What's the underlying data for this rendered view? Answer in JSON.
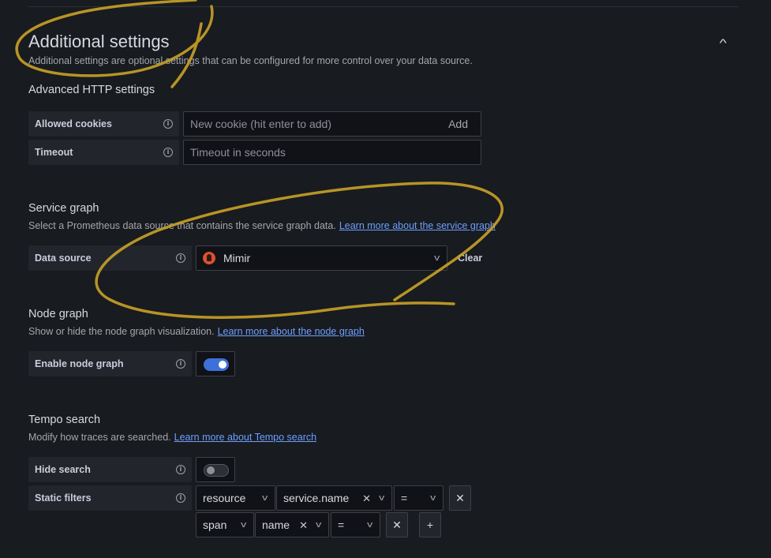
{
  "section": {
    "title": "Additional settings",
    "description": "Additional settings are optional settings that can be configured for more control over your data source."
  },
  "http": {
    "heading": "Advanced HTTP settings",
    "allowed_cookies_label": "Allowed cookies",
    "cookie_placeholder": "New cookie (hit enter to add)",
    "add_label": "Add",
    "timeout_label": "Timeout",
    "timeout_placeholder": "Timeout in seconds"
  },
  "service_graph": {
    "heading": "Service graph",
    "description": "Select a Prometheus data source that contains the service graph data.",
    "link": "Learn more about the service graph",
    "datasource_label": "Data source",
    "datasource_value": "Mimir",
    "clear_label": "Clear"
  },
  "node_graph": {
    "heading": "Node graph",
    "description": "Show or hide the node graph visualization.",
    "link": "Learn more about the node graph",
    "enable_label": "Enable node graph",
    "enabled": true
  },
  "tempo_search": {
    "heading": "Tempo search",
    "description": "Modify how traces are searched.",
    "link": "Learn more about Tempo search",
    "hide_search_label": "Hide search",
    "hide_search_enabled": false,
    "static_filters_label": "Static filters",
    "filters": [
      {
        "scope": "resource",
        "tag": "service.name",
        "operator": "="
      },
      {
        "scope": "span",
        "tag": "name",
        "operator": "="
      }
    ]
  },
  "icons": {
    "info": "info-icon",
    "chevron": "chevron-down-icon",
    "remove": "x-icon",
    "add": "plus-icon",
    "collapse": "chevron-up-icon",
    "mimir": "mimir-logo-icon"
  },
  "colors": {
    "background": "#181b1f",
    "link": "#6e9fff",
    "toggle_on": "#3d71d9",
    "annotation": "#c9a227",
    "mimir": "#e0502d"
  }
}
